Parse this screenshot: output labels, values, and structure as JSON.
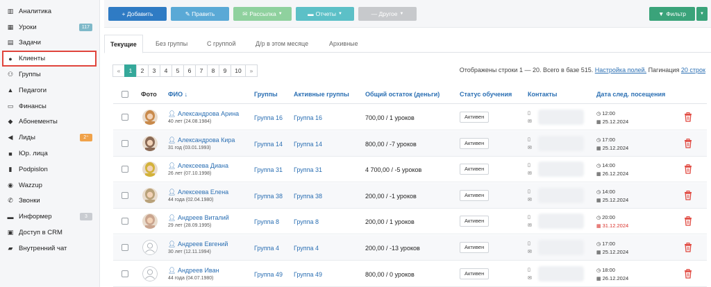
{
  "sidebar": {
    "items": [
      {
        "label": "Аналитика",
        "icon": "chart-icon",
        "glyph": "▥"
      },
      {
        "label": "Уроки",
        "icon": "calendar-icon",
        "glyph": "▦",
        "badge": "117",
        "badge_color": "#7fb9c9"
      },
      {
        "label": "Задачи",
        "icon": "clipboard-icon",
        "glyph": "▤"
      },
      {
        "label": "Клиенты",
        "icon": "user-icon",
        "glyph": "●",
        "active": true
      },
      {
        "label": "Группы",
        "icon": "users-icon",
        "glyph": "⚇"
      },
      {
        "label": "Педагоги",
        "icon": "graduation-cap-icon",
        "glyph": "▲"
      },
      {
        "label": "Финансы",
        "icon": "money-icon",
        "glyph": "▭"
      },
      {
        "label": "Абонементы",
        "icon": "tag-icon",
        "glyph": "◆"
      },
      {
        "label": "Лиды",
        "icon": "lead-icon",
        "glyph": "◀",
        "badge": "2⁺",
        "badge_color": "#f0a24a"
      },
      {
        "label": "Юр. лица",
        "icon": "briefcase-icon",
        "glyph": "■"
      },
      {
        "label": "Podpislon",
        "icon": "document-icon",
        "glyph": "▮"
      },
      {
        "label": "Wazzup",
        "icon": "whatsapp-icon",
        "glyph": "◉"
      },
      {
        "label": "Звонки",
        "icon": "phone-icon",
        "glyph": "✆"
      },
      {
        "label": "Информер",
        "icon": "inbox-icon",
        "glyph": "▬",
        "badge": "3",
        "badge_color": "#c9ccd1"
      },
      {
        "label": "Доступ в CRM",
        "icon": "lock-icon",
        "glyph": "▣"
      },
      {
        "label": "Внутренний чат",
        "icon": "chat-icon",
        "glyph": "▰"
      }
    ]
  },
  "toolbar": {
    "add": "+ Добавить",
    "edit": "✎ Править",
    "mailing": "Рассылка",
    "reports": "Отчеты",
    "other": "— Другое",
    "filter": "Фильтр",
    "colors": {
      "add": "#2f7bc4",
      "edit": "#5aa9d6",
      "mailing": "#8fd19e",
      "reports": "#5cc0c7",
      "other": "#c7c9cc",
      "filter": "#3aa37a"
    }
  },
  "tabs": [
    "Текущие",
    "Без группы",
    "С группой",
    "Д/р в этом месяце",
    "Архивные"
  ],
  "pagination": {
    "prev": "«",
    "pages": [
      "1",
      "2",
      "3",
      "4",
      "5",
      "6",
      "7",
      "8",
      "9",
      "10"
    ],
    "next": "»"
  },
  "summary": {
    "text": "Отображены строки 1 — 20. Всего в базе 515.",
    "settings": "Настройка полей.",
    "pagination_label": "Пагинация",
    "rows_link": "20 строк"
  },
  "table": {
    "headers": {
      "photo": "Фото",
      "fio": "ФИО ↓",
      "groups": "Группы",
      "active_groups": "Активные группы",
      "balance": "Общий остаток (деньги)",
      "status": "Статус обучения",
      "contacts": "Контакты",
      "next_visit": "Дата след. посещения"
    },
    "rows": [
      {
        "name": "Александрова Арина",
        "sub": "40 лет (24.08.1984)",
        "group": "Группа 16",
        "active_group": "Группа 16",
        "balance": "700,00 / 1 уроков",
        "status": "Активен",
        "time": "12:00",
        "date": "25.12.2024",
        "date_red": false,
        "photo": "photo",
        "avatar_color": "#c98a4b"
      },
      {
        "name": "Александрова Кира",
        "sub": "31 год (03.01.1993)",
        "group": "Группа 14",
        "active_group": "Группа 14",
        "balance": "800,00 / -7 уроков",
        "status": "Активен",
        "time": "17:00",
        "date": "25.12.2024",
        "date_red": false,
        "photo": "photo",
        "avatar_color": "#8a6a55"
      },
      {
        "name": "Алексеева Диана",
        "sub": "26 лет (07.10.1998)",
        "group": "Группа 31",
        "active_group": "Группа 31",
        "balance": "4 700,00 / -5 уроков",
        "status": "Активен",
        "time": "14:00",
        "date": "26.12.2024",
        "date_red": false,
        "photo": "photo",
        "avatar_color": "#d3b23a"
      },
      {
        "name": "Алексеева Елена",
        "sub": "44 года (02.04.1980)",
        "group": "Группа 38",
        "active_group": "Группа 38",
        "balance": "200,00 / -1 уроков",
        "status": "Активен",
        "time": "14:00",
        "date": "25.12.2024",
        "date_red": false,
        "photo": "photo",
        "avatar_color": "#b9a27a"
      },
      {
        "name": "Андреев Виталий",
        "sub": "29 лет (28.09.1995)",
        "group": "Группа 8",
        "active_group": "Группа 8",
        "balance": "200,00 / 1 уроков",
        "status": "Активен",
        "time": "20:00",
        "date": "31.12.2024",
        "date_red": true,
        "photo": "photo",
        "avatar_color": "#caa58f"
      },
      {
        "name": "Андреев Евгений",
        "sub": "30 лет (12.11.1994)",
        "group": "Группа 4",
        "active_group": "Группа 4",
        "balance": "200,00 / -13 уроков",
        "status": "Активен",
        "time": "17:00",
        "date": "25.12.2024",
        "date_red": false,
        "photo": "placeholder",
        "avatar_color": "#dfe2e6"
      },
      {
        "name": "Андреев Иван",
        "sub": "44 года (04.07.1980)",
        "group": "Группа 49",
        "active_group": "Группа 49",
        "balance": "800,00 / 0 уроков",
        "status": "Активен",
        "time": "18:00",
        "date": "26.12.2024",
        "date_red": false,
        "photo": "placeholder",
        "avatar_color": "#dfe2e6"
      }
    ]
  }
}
